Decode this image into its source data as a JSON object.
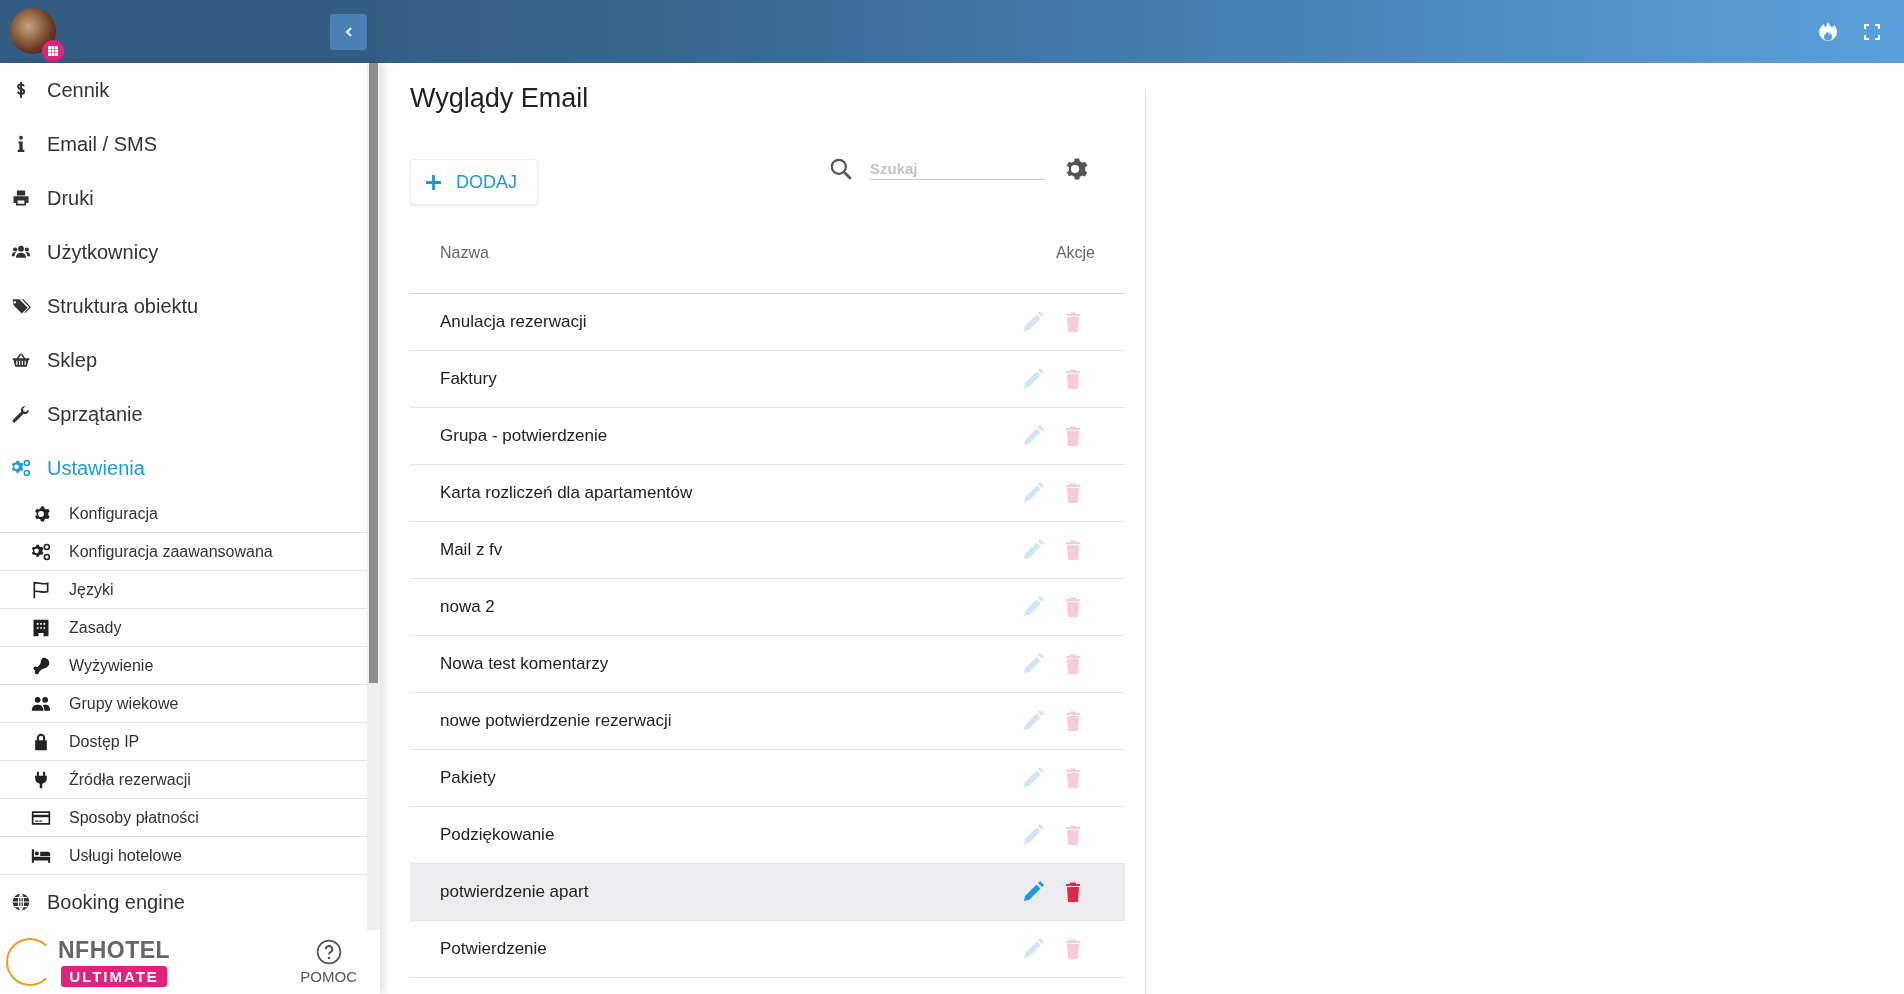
{
  "sidebar": {
    "items": [
      {
        "label": "Cennik",
        "selected": false
      },
      {
        "label": "Email / SMS",
        "selected": false
      },
      {
        "label": "Druki",
        "selected": false
      },
      {
        "label": "Użytkownicy",
        "selected": false
      },
      {
        "label": "Struktura obiektu",
        "selected": false
      },
      {
        "label": "Sklep",
        "selected": false
      },
      {
        "label": "Sprzątanie",
        "selected": false
      },
      {
        "label": "Ustawienia",
        "selected": true,
        "children": [
          {
            "label": "Konfiguracja",
            "selected": false
          },
          {
            "label": "Konfiguracja zaawansowana",
            "selected": false
          },
          {
            "label": "Języki",
            "selected": false
          },
          {
            "label": "Zasady",
            "selected": false
          },
          {
            "label": "Wyżywienie",
            "selected": false
          },
          {
            "label": "Grupy wiekowe",
            "selected": false
          },
          {
            "label": "Dostęp IP",
            "selected": false
          },
          {
            "label": "Źródła rezerwacji",
            "selected": false
          },
          {
            "label": "Sposoby płatności",
            "selected": false
          },
          {
            "label": "Usługi hotelowe",
            "selected": false
          }
        ]
      },
      {
        "label": "Booking engine",
        "selected": false
      }
    ],
    "footer": {
      "logo_text": "NFHOTEL",
      "edition_badge": "ULTIMATE",
      "help_label": "POMOC"
    }
  },
  "page": {
    "title": "Wyglądy Email",
    "add_button": "DODAJ",
    "search": {
      "placeholder": "Szukaj"
    }
  },
  "table": {
    "columns": [
      "Nazwa",
      "Akcje"
    ],
    "rows": [
      {
        "name": "Anulacja rezerwacji",
        "highlighted": false
      },
      {
        "name": "Faktury",
        "highlighted": false
      },
      {
        "name": "Grupa - potwierdzenie",
        "highlighted": false
      },
      {
        "name": "Karta rozliczeń dla apartamentów",
        "highlighted": false
      },
      {
        "name": "Mail z fv",
        "highlighted": false
      },
      {
        "name": "nowa 2",
        "highlighted": false
      },
      {
        "name": "Nowa test komentarzy",
        "highlighted": false
      },
      {
        "name": "nowe potwierdzenie rezerwacji",
        "highlighted": false
      },
      {
        "name": "Pakiety",
        "highlighted": false
      },
      {
        "name": "Podziękowanie",
        "highlighted": false
      },
      {
        "name": "potwierdzenie apart",
        "highlighted": true
      },
      {
        "name": "Potwierdzenie",
        "highlighted": false
      }
    ]
  }
}
